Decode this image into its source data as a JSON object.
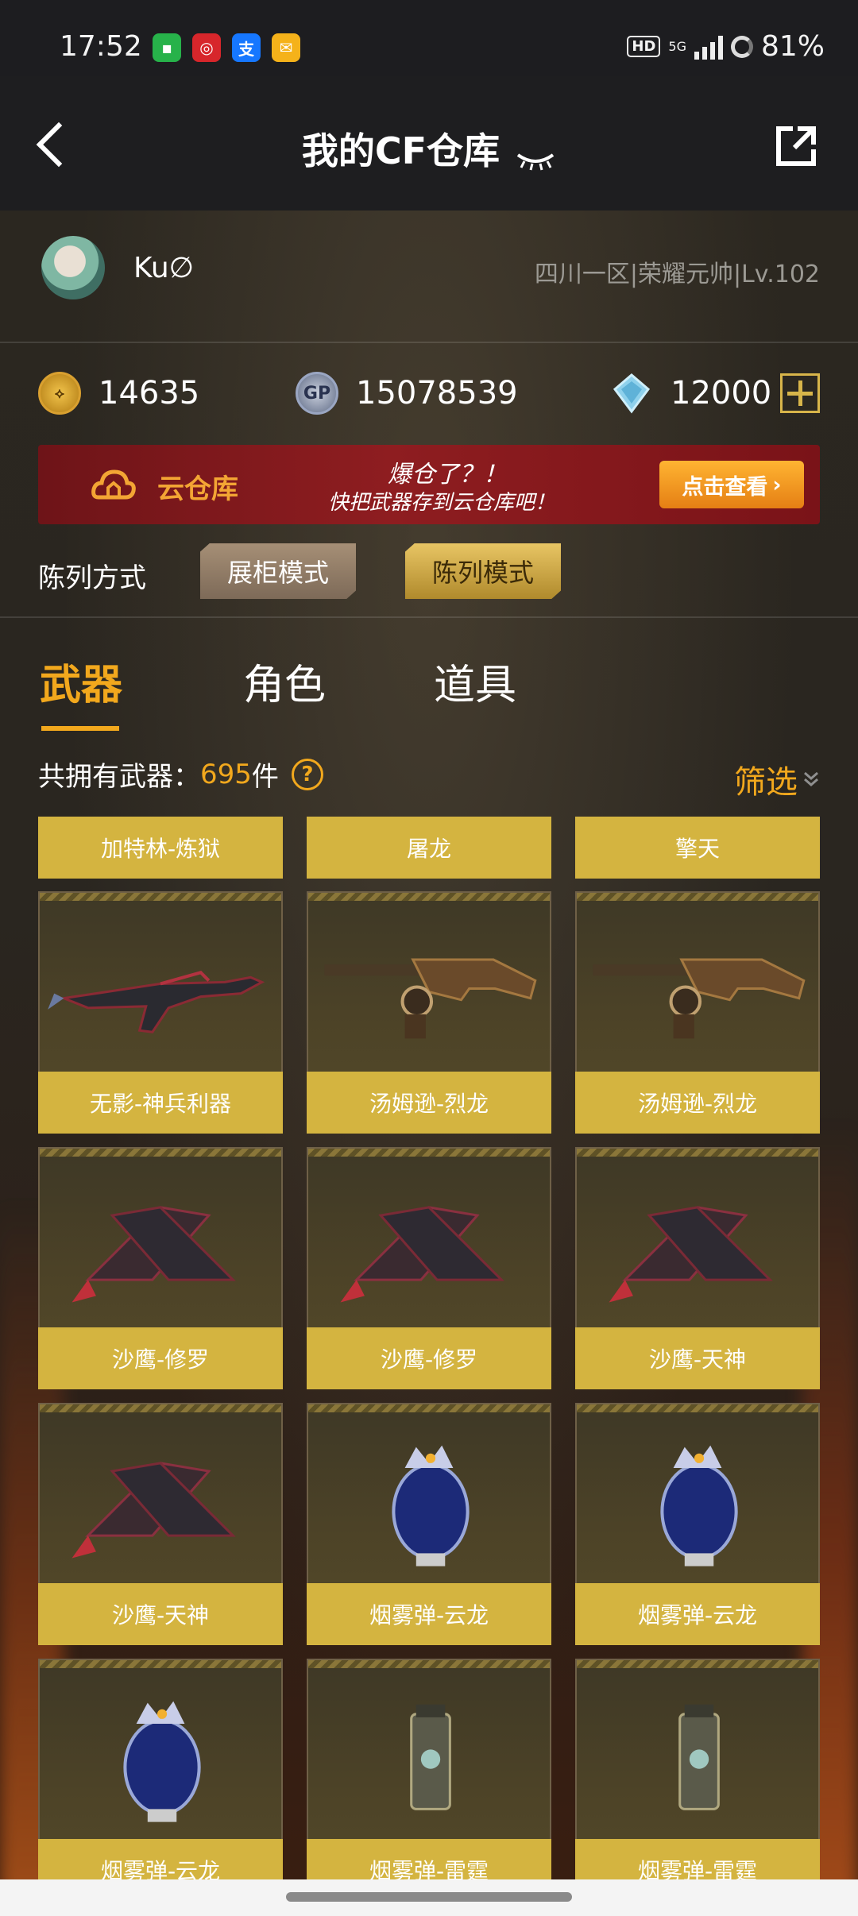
{
  "status_bar": {
    "time": "17:52",
    "network": "5G",
    "hd": "HD",
    "battery": "81%"
  },
  "header": {
    "title": "我的CF仓库"
  },
  "profile": {
    "username": "Ku∅",
    "server_info": "四川一区|荣耀元帅|Lv.102"
  },
  "currency": {
    "cf_points": "14635",
    "gp": "15078539",
    "diamonds": "12000",
    "gp_icon_text": "GP"
  },
  "banner": {
    "title": "云仓库",
    "slogan_line1": "爆仓了？！",
    "slogan_line2": "快把武器存到云仓库吧！",
    "button_label": "点击查看"
  },
  "display_mode": {
    "label": "陈列方式",
    "options": [
      "展柜模式",
      "陈列模式"
    ],
    "selected": "陈列模式"
  },
  "tabs": [
    {
      "label": "武器",
      "active": true
    },
    {
      "label": "角色",
      "active": false
    },
    {
      "label": "道具",
      "active": false
    }
  ],
  "weapons_count": {
    "prefix": "共拥有武器：",
    "count": "695",
    "suffix": "件"
  },
  "filter": {
    "label": "筛选"
  },
  "items_top_labels": [
    "加特林-炼狱",
    "屠龙",
    "擎天"
  ],
  "items": [
    {
      "name": "无影-神兵利器",
      "icon": "rifle-icon"
    },
    {
      "name": "汤姆逊-烈龙",
      "icon": "smg-icon"
    },
    {
      "name": "汤姆逊-烈龙",
      "icon": "smg-icon"
    },
    {
      "name": "沙鹰-修罗",
      "icon": "pistol-icon"
    },
    {
      "name": "沙鹰-修罗",
      "icon": "pistol-icon"
    },
    {
      "name": "沙鹰-天神",
      "icon": "pistol-icon"
    },
    {
      "name": "沙鹰-天神",
      "icon": "pistol-icon"
    },
    {
      "name": "烟雾弹-云龙",
      "icon": "grenade-icon"
    },
    {
      "name": "烟雾弹-云龙",
      "icon": "grenade-icon"
    },
    {
      "name": "烟雾弹-云龙",
      "icon": "grenade-icon"
    },
    {
      "name": "烟雾弹-雷霆",
      "icon": "canister-icon"
    },
    {
      "name": "烟雾弹-雷霆",
      "icon": "canister-icon"
    }
  ]
}
